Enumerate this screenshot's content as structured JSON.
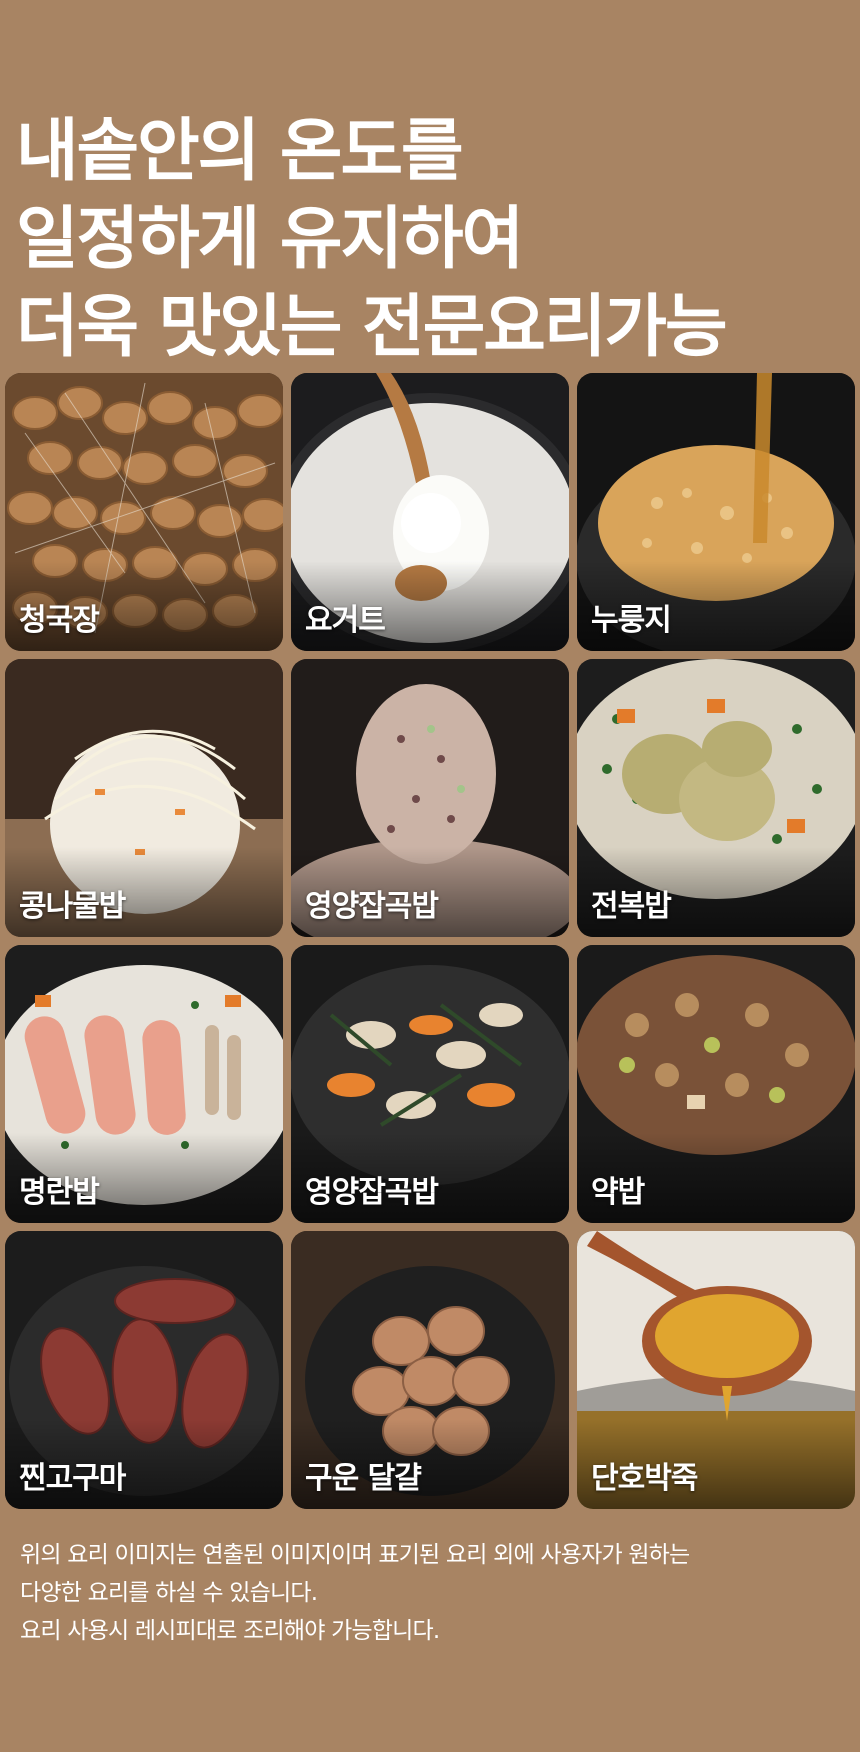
{
  "headline": {
    "line1": "내솥안의 온도를",
    "line2": "일정하게 유지하여",
    "line3": "더욱 맛있는 전문요리가능"
  },
  "dishes": [
    {
      "label": "청국장"
    },
    {
      "label": "요거트"
    },
    {
      "label": "누룽지"
    },
    {
      "label": "콩나물밥"
    },
    {
      "label": "영양잡곡밥"
    },
    {
      "label": "전복밥"
    },
    {
      "label": "명란밥"
    },
    {
      "label": "영양잡곡밥"
    },
    {
      "label": "약밥"
    },
    {
      "label": "찐고구마"
    },
    {
      "label": "구운 달걀"
    },
    {
      "label": "단호박죽"
    }
  ],
  "notice": {
    "line1": "위의 요리 이미지는 연출된 이미지이며 표기된 요리 외에 사용자가 원하는",
    "line2": "다양한 요리를 하실 수 있습니다.",
    "line3": "요리 사용시 레시피대로 조리해야 가능합니다."
  },
  "colors": {
    "background": "#a88463",
    "text": "#ffffff"
  }
}
